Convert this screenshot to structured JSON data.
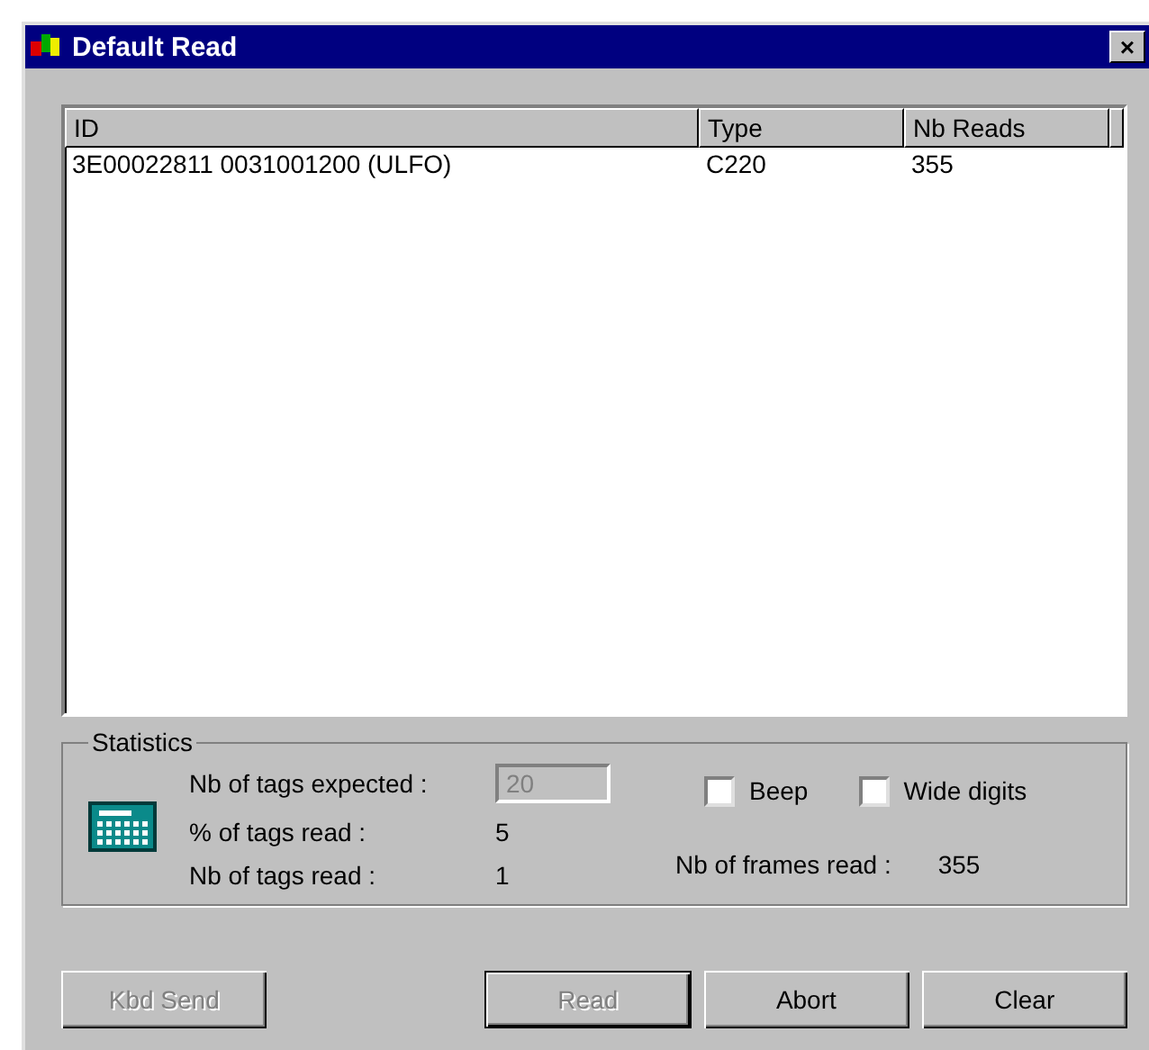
{
  "window": {
    "title": "Default Read",
    "close_label": "×"
  },
  "table": {
    "columns": [
      "ID",
      "Type",
      "Nb Reads"
    ],
    "rows": [
      {
        "cells": [
          "3E00022811 0031001200 (ULFO)",
          "C220",
          "355"
        ]
      }
    ]
  },
  "statistics": {
    "title": "Statistics",
    "expected_label": "Nb of tags expected :",
    "expected_value": "20",
    "expected_disabled": true,
    "percent_label": "% of tags read :",
    "percent_value": "5",
    "count_label": "Nb of tags read :",
    "count_value": "1",
    "checkboxes": [
      {
        "label": "Beep",
        "checked": false
      },
      {
        "label": "Wide digits",
        "checked": false
      }
    ],
    "frames_label": "Nb of frames read :",
    "frames_value": "355"
  },
  "buttons": [
    {
      "label": "Kbd Send",
      "disabled": true,
      "default": false
    },
    {
      "label": "Read",
      "disabled": true,
      "default": true
    },
    {
      "label": "Abort",
      "disabled": false,
      "default": false
    },
    {
      "label": "Clear",
      "disabled": false,
      "default": false
    }
  ]
}
